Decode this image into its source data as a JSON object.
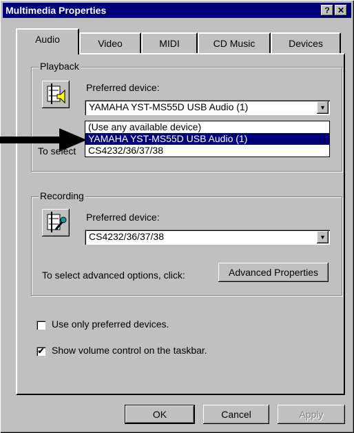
{
  "window": {
    "title": "Multimedia Properties",
    "help_btn": "?",
    "close_btn": "✕"
  },
  "tabs": [
    "Audio",
    "Video",
    "MIDI",
    "CD Music",
    "Devices"
  ],
  "playback": {
    "group_label": "Playback",
    "preferred_label": "Preferred device:",
    "selected": "YAMAHA YST-MS55D USB Audio (1)",
    "options": [
      "(Use any available device)",
      "YAMAHA YST-MS55D USB Audio (1)",
      "CS4232/36/37/38"
    ],
    "partial_text": "To select"
  },
  "recording": {
    "group_label": "Recording",
    "preferred_label": "Preferred device:",
    "selected": "CS4232/36/37/38",
    "advanced_text": "To select advanced options, click:",
    "advanced_button": "Advanced Properties"
  },
  "options": {
    "use_only_preferred": {
      "label": "Use only preferred devices.",
      "checked": false
    },
    "show_volume": {
      "label": "Show volume control on the taskbar.",
      "checked": true
    }
  },
  "buttons": {
    "ok": "OK",
    "cancel": "Cancel",
    "apply": "Apply"
  },
  "check_mark": "✔"
}
